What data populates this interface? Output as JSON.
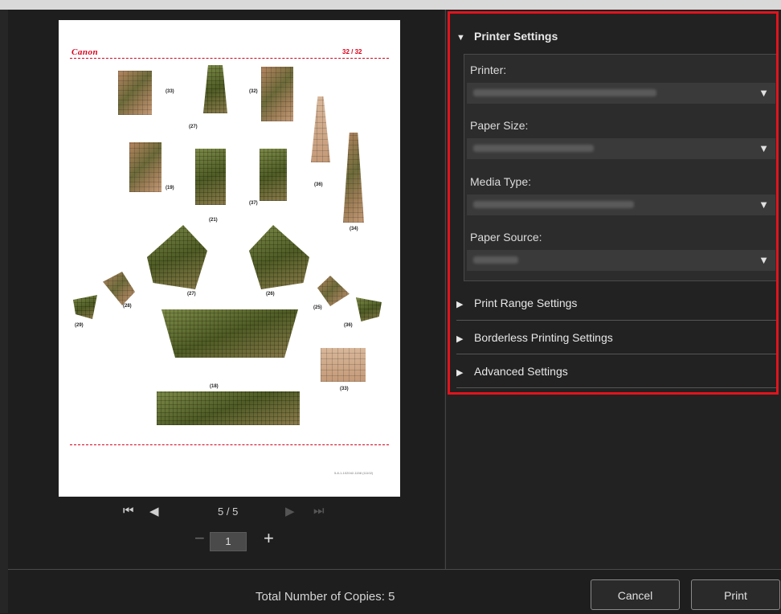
{
  "preview": {
    "brand": "Canon",
    "page_code": "32 / 32",
    "footnote": "5-8-1-102042-1158 (11102)",
    "pieces": [
      {
        "label": "(33)"
      },
      {
        "label": "(27)"
      },
      {
        "label": "(32)"
      },
      {
        "label": "(19)"
      },
      {
        "label": "(21)"
      },
      {
        "label": "(37)"
      },
      {
        "label": "(36)"
      },
      {
        "label": "(34)"
      },
      {
        "label": "(27)"
      },
      {
        "label": "(26)"
      },
      {
        "label": "(28)"
      },
      {
        "label": "(29)"
      },
      {
        "label": "(25)"
      },
      {
        "label": "(36)"
      },
      {
        "label": "(18)"
      },
      {
        "label": "(33)"
      }
    ]
  },
  "navigation": {
    "first_icon": "skip-first-icon",
    "prev_icon": "prev-page-icon",
    "next_icon": "next-page-icon",
    "last_icon": "skip-last-icon",
    "page_indicator": "5 / 5"
  },
  "copies": {
    "minus_label": "−",
    "value": "1",
    "plus_label": "+"
  },
  "printer_settings": {
    "title": "Printer Settings",
    "fields": [
      {
        "label": "Printer:"
      },
      {
        "label": "Paper Size:"
      },
      {
        "label": "Media Type:"
      },
      {
        "label": "Paper Source:"
      }
    ]
  },
  "sections": [
    {
      "label": "Print Range Settings"
    },
    {
      "label": "Borderless Printing Settings"
    },
    {
      "label": "Advanced Settings"
    }
  ],
  "footer": {
    "total_copies": "Total Number of Copies: 5",
    "cancel_label": "Cancel",
    "print_label": "Print"
  },
  "colors": {
    "highlight": "#e0141d",
    "brand_red": "#d7001a"
  }
}
